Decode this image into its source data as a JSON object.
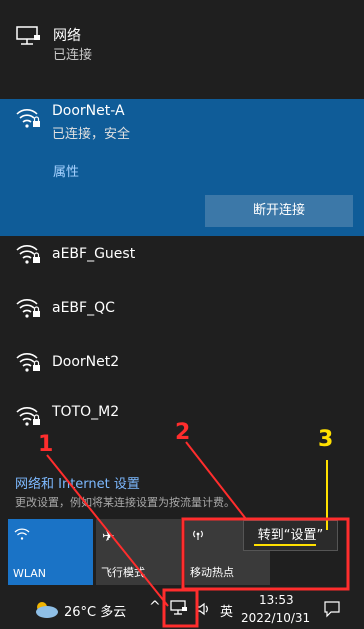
{
  "network_header": {
    "title": "网络",
    "status": "已连接"
  },
  "connected": {
    "name": "DoorNet-A",
    "status": "已连接，安全",
    "properties": "属性",
    "disconnect": "断开连接"
  },
  "networks": [
    {
      "name": "aEBF_Guest"
    },
    {
      "name": "aEBF_QC"
    },
    {
      "name": "DoorNet2"
    },
    {
      "name": "TOTO_M2"
    }
  ],
  "settings": {
    "link": "网络和 Internet 设置",
    "desc": "更改设置，例如将某连接设置为按流量计费。"
  },
  "quick_actions": [
    {
      "label": "WLAN",
      "state": "on"
    },
    {
      "label": "飞行模式",
      "state": "off"
    },
    {
      "label": "移动热点",
      "state": "off"
    }
  ],
  "tooltip": "转到“设置”",
  "taskbar": {
    "weather": "26°C  多云",
    "ime": "英",
    "time": "13:53",
    "date": "2022/10/31"
  },
  "annotations": [
    "1",
    "2",
    "3"
  ],
  "colors": {
    "accent": "#0f5c98",
    "annotation": "#ff2d2d",
    "highlight": "#ffe000"
  }
}
